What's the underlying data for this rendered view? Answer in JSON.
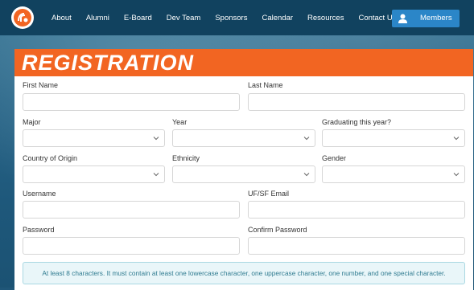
{
  "nav": {
    "links": [
      "About",
      "Alumni",
      "E-Board",
      "Dev Team",
      "Sponsors",
      "Calendar",
      "Resources",
      "Contact Us"
    ],
    "members_label": "Members"
  },
  "form": {
    "title": "REGISTRATION",
    "first_name_label": "First Name",
    "last_name_label": "Last Name",
    "major_label": "Major",
    "year_label": "Year",
    "graduating_label": "Graduating this year?",
    "country_label": "Country of Origin",
    "ethnicity_label": "Ethnicity",
    "gender_label": "Gender",
    "username_label": "Username",
    "email_label": "UF/SF Email",
    "password_label": "Password",
    "confirm_password_label": "Confirm Password",
    "password_hint": "At least 8 characters. It must contain at least one lowercase character, one uppercase character, one number, and one special character."
  },
  "colors": {
    "nav_bg": "#11425f",
    "accent": "#f26522",
    "members_button": "#2b86c8",
    "info_bg": "#e9f6f9",
    "info_text": "#2f7b90"
  }
}
